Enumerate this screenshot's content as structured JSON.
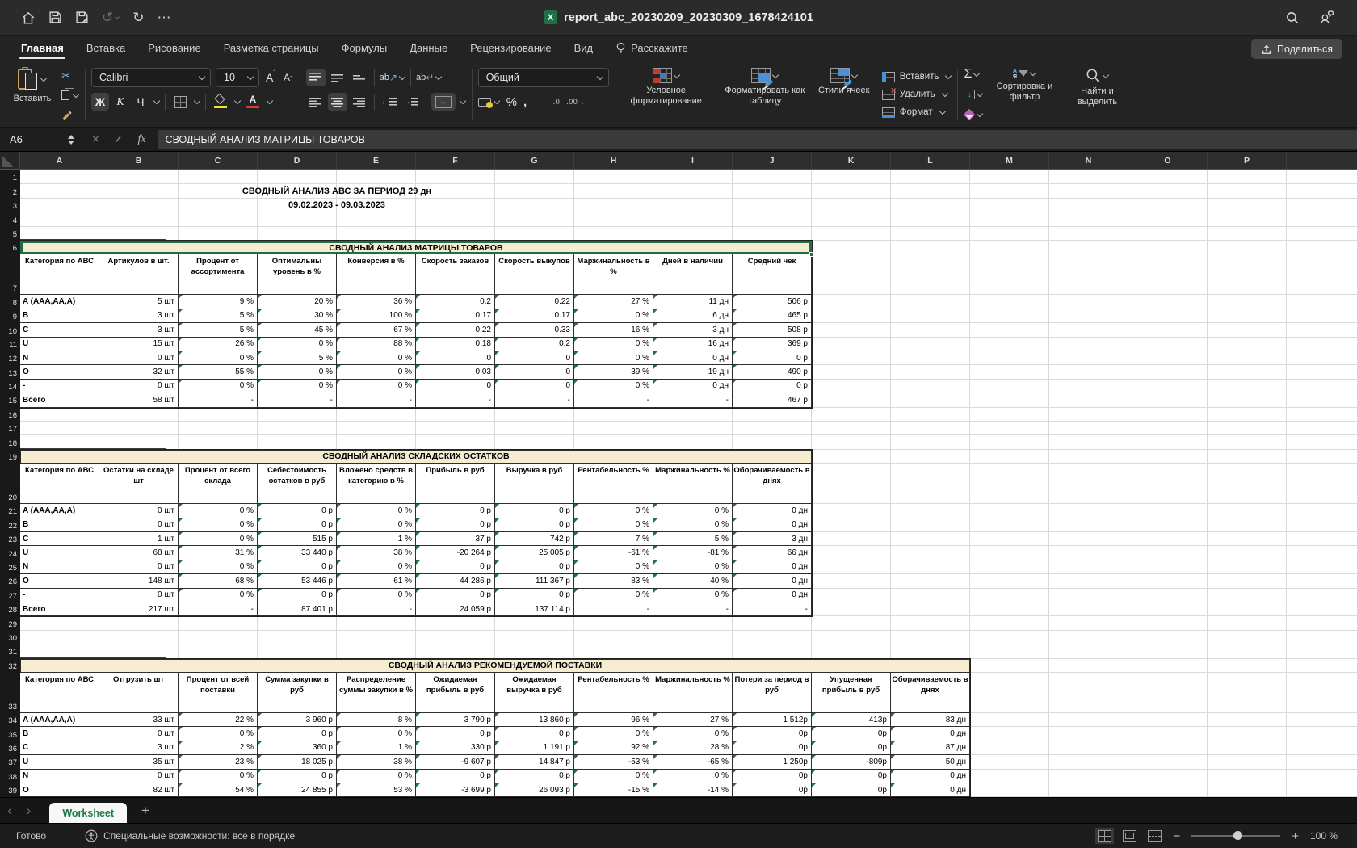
{
  "colors": {
    "excel_green": "#217346",
    "selection_green": "#1d7044",
    "table_title_bg": "#f5ecd2",
    "active_tab_underline": "#e8e8e8",
    "sheet_tab_text": "#1a7a44"
  },
  "titlebar": {
    "filename": "report_abc_20230209_20230309_1678424101",
    "share_label": "Поделиться"
  },
  "tabs": {
    "items": [
      {
        "label": "Главная",
        "active": true
      },
      {
        "label": "Вставка"
      },
      {
        "label": "Рисование"
      },
      {
        "label": "Разметка страницы"
      },
      {
        "label": "Формулы"
      },
      {
        "label": "Данные"
      },
      {
        "label": "Рецензирование"
      },
      {
        "label": "Вид"
      },
      {
        "label": "Расскажите",
        "bulb": true
      }
    ]
  },
  "ribbon": {
    "paste_label": "Вставить",
    "font_name": "Calibri",
    "font_size": "10",
    "bold_glyph": "Ж",
    "italic_glyph": "К",
    "underline_glyph": "Ч",
    "number_format": "Общий",
    "percent_glyph": "%",
    "comma_glyph": ",",
    "inc_decimal": "←.0",
    "dec_decimal": ".00→",
    "sigma_glyph": "Σ",
    "cond_format_label": "Условное форматирование",
    "format_table_label": "Форматировать как таблицу",
    "cell_styles_label": "Стили ячеек",
    "insert_label": "Вставить",
    "delete_label": "Удалить",
    "format_label": "Формат",
    "sort_filter_label": "Сортировка и фильтр",
    "find_select_label": "Найти и выделить"
  },
  "formula_bar": {
    "cell_ref": "A6",
    "fx_label": "fx",
    "content": "СВОДНЫЙ АНАЛИЗ МАТРИЦЫ ТОВАРОВ"
  },
  "grid": {
    "col_letters": [
      "A",
      "B",
      "C",
      "D",
      "E",
      "F",
      "G",
      "H",
      "I",
      "J",
      "K",
      "L",
      "M",
      "N",
      "O",
      "P"
    ],
    "row_count": 39
  },
  "doc_header": {
    "line1": "СВОДНЫЙ АНАЛИЗ АВС ЗА ПЕРИОД 29 дн",
    "line2": "09.02.2023 - 09.03.2023"
  },
  "tables": [
    {
      "title": "СВОДНЫЙ АНАЛИЗ МАТРИЦЫ ТОВАРОВ",
      "headers": [
        "Категория по АВС",
        "Артикулов в шт.",
        "Процент от ассортимента",
        "Оптимальны уровень в %",
        "Конверсия в %",
        "Скорость заказов",
        "Скорость выкупов",
        "Маржинальность в %",
        "Дней в наличии",
        "Средний чек"
      ],
      "rows": [
        [
          "A (AAA,AA,A)",
          "5 шт",
          "9 %",
          "20 %",
          "36 %",
          "0.2",
          "0.22",
          "27 %",
          "11 дн",
          "506 р"
        ],
        [
          "B",
          "3 шт",
          "5 %",
          "30 %",
          "100 %",
          "0.17",
          "0.17",
          "0 %",
          "6 дн",
          "465 р"
        ],
        [
          "C",
          "3 шт",
          "5 %",
          "45 %",
          "67 %",
          "0.22",
          "0.33",
          "16 %",
          "3 дн",
          "508 р"
        ],
        [
          "U",
          "15 шт",
          "26 %",
          "0 %",
          "88 %",
          "0.18",
          "0.2",
          "0 %",
          "16 дн",
          "369 р"
        ],
        [
          "N",
          "0 шт",
          "0 %",
          "5 %",
          "0 %",
          "0",
          "0",
          "0 %",
          "0 дн",
          "0 р"
        ],
        [
          "O",
          "32 шт",
          "55 %",
          "0 %",
          "0 %",
          "0.03",
          "0",
          "39 %",
          "19 дн",
          "490 р"
        ],
        [
          "-",
          "0 шт",
          "0 %",
          "0 %",
          "0 %",
          "0",
          "0",
          "0 %",
          "0 дн",
          "0 р"
        ],
        [
          "Всего",
          "58 шт",
          "-",
          "-",
          "-",
          "-",
          "-",
          "-",
          "-",
          "467 р"
        ]
      ]
    },
    {
      "title": "СВОДНЫЙ АНАЛИЗ СКЛАДСКИХ ОСТАТКОВ",
      "headers": [
        "Категория по АВС",
        "Остатки на складе шт",
        "Процент от всего склада",
        "Себестоимость остатков в руб",
        "Вложено средств в категорию в %",
        "Прибыль в руб",
        "Выручка в руб",
        "Рентабельность %",
        "Маржинальность %",
        "Оборачиваемость в днях"
      ],
      "rows": [
        [
          "A (AAA,AA,A)",
          "0 шт",
          "0 %",
          "0 р",
          "0 %",
          "0 р",
          "0 р",
          "0 %",
          "0 %",
          "0 дн"
        ],
        [
          "B",
          "0 шт",
          "0 %",
          "0 р",
          "0 %",
          "0 р",
          "0 р",
          "0 %",
          "0 %",
          "0 дн"
        ],
        [
          "C",
          "1 шт",
          "0 %",
          "515 р",
          "1 %",
          "37 р",
          "742 р",
          "7 %",
          "5 %",
          "3 дн"
        ],
        [
          "U",
          "68 шт",
          "31 %",
          "33 440 р",
          "38 %",
          "-20 264 р",
          "25 005 р",
          "-61 %",
          "-81 %",
          "66 дн"
        ],
        [
          "N",
          "0 шт",
          "0 %",
          "0 р",
          "0 %",
          "0 р",
          "0 р",
          "0 %",
          "0 %",
          "0 дн"
        ],
        [
          "O",
          "148 шт",
          "68 %",
          "53 446 р",
          "61 %",
          "44 286 р",
          "111 367 р",
          "83 %",
          "40 %",
          "0 дн"
        ],
        [
          "-",
          "0 шт",
          "0 %",
          "0 р",
          "0 %",
          "0 р",
          "0 р",
          "0 %",
          "0 %",
          "0 дн"
        ],
        [
          "Всего",
          "217 шт",
          "-",
          "87 401 р",
          "-",
          "24 059 р",
          "137 114 р",
          "-",
          "-",
          "-"
        ]
      ]
    },
    {
      "title": "СВОДНЫЙ АНАЛИЗ РЕКОМЕНДУЕМОЙ ПОСТАВКИ",
      "headers": [
        "Категория по АВС",
        "Отгрузить шт",
        "Процент от всей поставки",
        "Сумма закупки в руб",
        "Распределение суммы закупки в %",
        "Ожидаемая прибыль в руб",
        "Ожидаемая выручка в руб",
        "Рентабельность %",
        "Маржинальность %",
        "Потери за период в руб",
        "Упущенная прибыль в руб",
        "Оборачиваемость в днях"
      ],
      "rows": [
        [
          "A (AAA,AA,A)",
          "33 шт",
          "22 %",
          "3 960 р",
          "8 %",
          "3 790 р",
          "13 860 р",
          "96 %",
          "27 %",
          "1 512р",
          "413р",
          "83 дн"
        ],
        [
          "B",
          "0 шт",
          "0 %",
          "0 р",
          "0 %",
          "0 р",
          "0 р",
          "0 %",
          "0 %",
          "0р",
          "0р",
          "0 дн"
        ],
        [
          "C",
          "3 шт",
          "2 %",
          "360 р",
          "1 %",
          "330 р",
          "1 191 р",
          "92 %",
          "28 %",
          "0р",
          "0р",
          "87 дн"
        ],
        [
          "U",
          "35 шт",
          "23 %",
          "18 025 р",
          "38 %",
          "-9 607 р",
          "14 847 р",
          "-53 %",
          "-65 %",
          "1 250р",
          "-809р",
          "50 дн"
        ],
        [
          "N",
          "0 шт",
          "0 %",
          "0 р",
          "0 %",
          "0 р",
          "0 р",
          "0 %",
          "0 %",
          "0р",
          "0р",
          "0 дн"
        ],
        [
          "O",
          "82 шт",
          "54 %",
          "24 855 р",
          "53 %",
          "-3 699 р",
          "26 093 р",
          "-15 %",
          "-14 %",
          "0р",
          "0р",
          "0 дн"
        ]
      ]
    }
  ],
  "sheet_bar": {
    "tab_label": "Worksheet",
    "add_label": "+"
  },
  "status_bar": {
    "ready": "Готово",
    "accessibility": "Специальные возможности: все в порядке",
    "zoom_value": "100 %"
  }
}
